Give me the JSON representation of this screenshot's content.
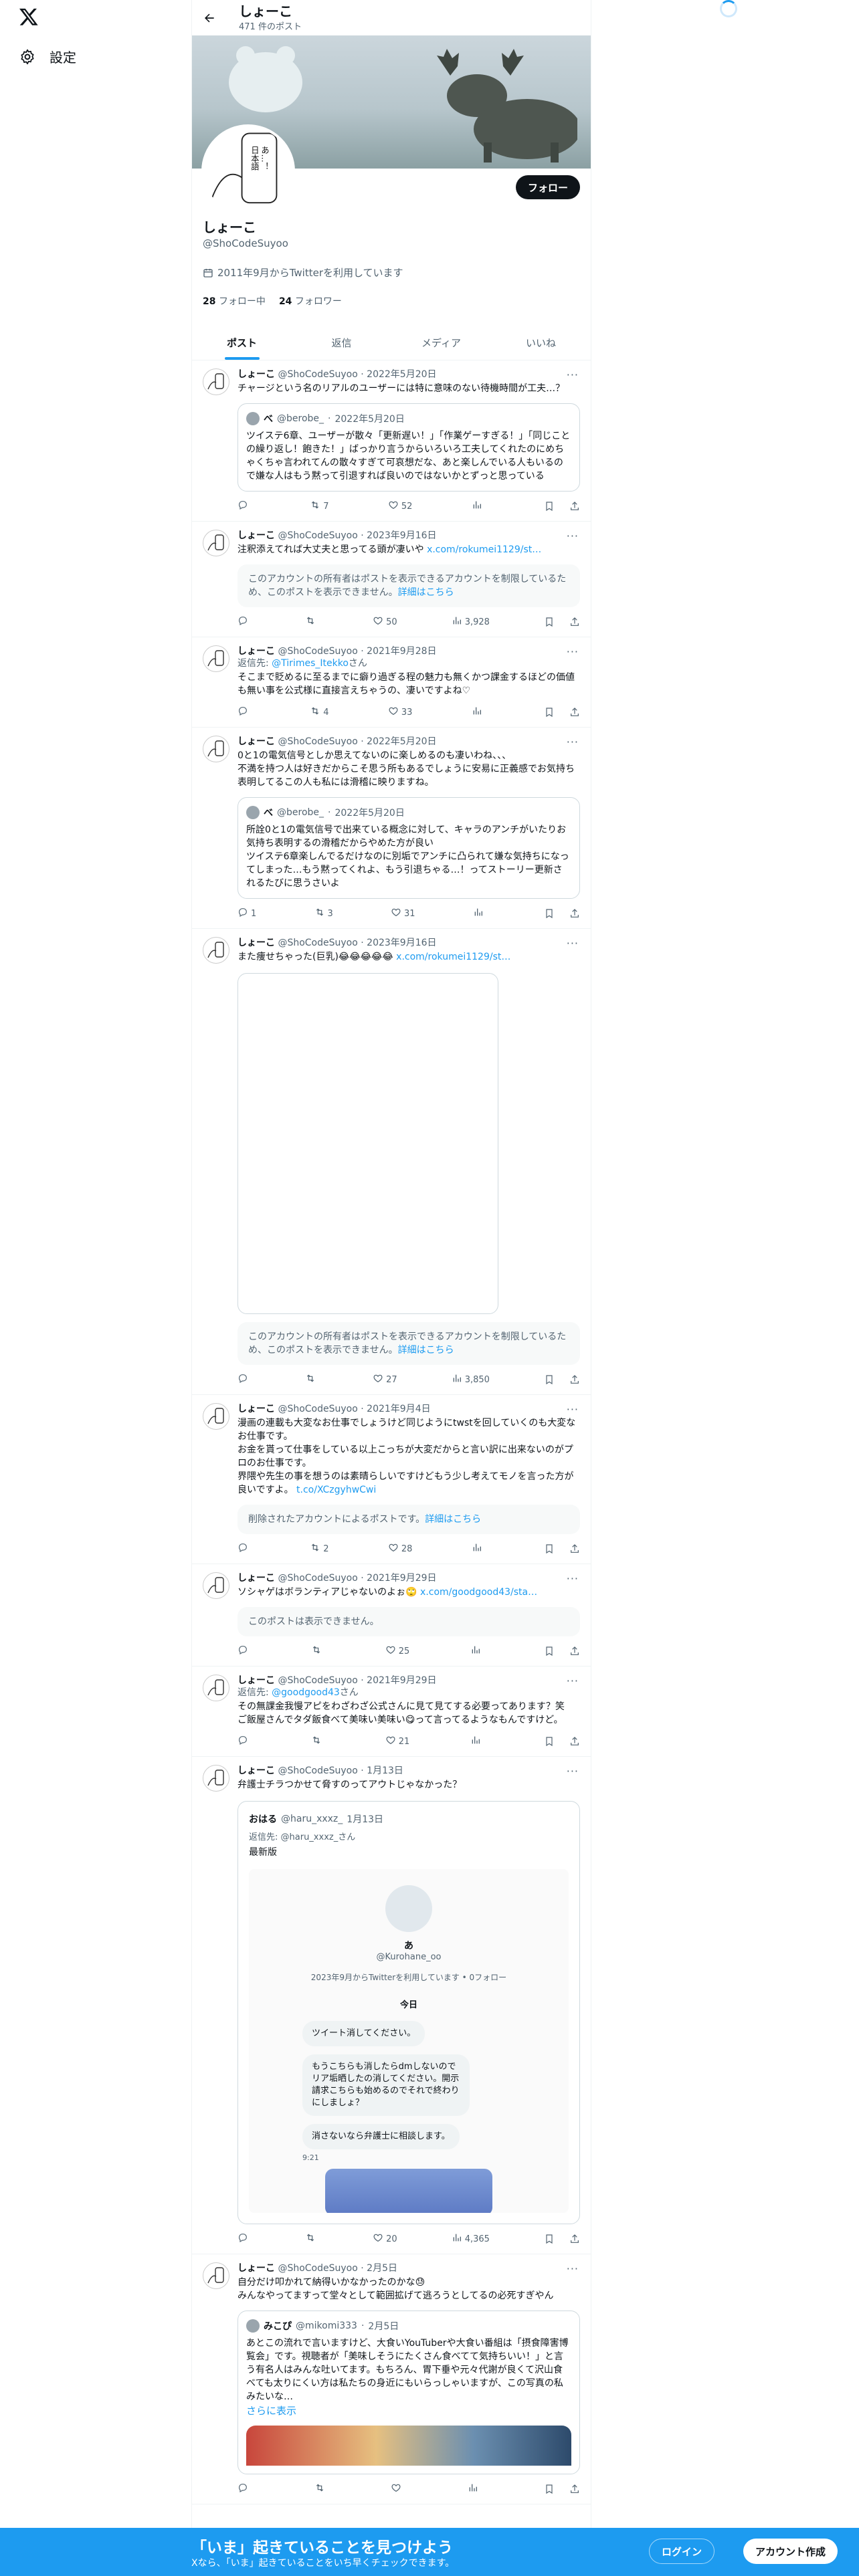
{
  "settings_label": "設定",
  "header": {
    "title": "しょーこ",
    "post_count": "471 件のポスト"
  },
  "banner": {
    "vertical_text": "あ…！日本語むずかちな…"
  },
  "follow_label": "フォロー",
  "profile": {
    "name": "しょーこ",
    "handle": "@ShoCodeSuyoo",
    "joined": "2011年9月からTwitterを利用しています",
    "following_count": "28",
    "following_label": "フォロー中",
    "followers_count": "24",
    "followers_label": "フォロワー"
  },
  "tabs": [
    "ポスト",
    "返信",
    "メディア",
    "いいね"
  ],
  "posts": [
    {
      "name": "しょーこ",
      "handle": "@ShoCodeSuyoo",
      "date": "2022年5月20日",
      "text": "チャージという名のリアルのユーザーには特に意味のない待機時間が工夫…？",
      "quote": {
        "name": "べ",
        "handle": "@berobe_",
        "date": "2022年5月20日",
        "text": "ツイステ6章、ユーザーが散々「更新遅い！」「作業ゲーすぎる！」「同じことの繰り返し！飽きた！」ばっかり言うからいろいろ工夫してくれたのにめちゃくちゃ言われてんの散々すぎて可哀想だな、あと楽しんでいる人もいるので嫌な人はもう黙って引退すれば良いのではないかとずっと思っている"
      },
      "replies": "",
      "reposts": "7",
      "likes": "52",
      "views": ""
    },
    {
      "name": "しょーこ",
      "handle": "@ShoCodeSuyoo",
      "date": "2023年9月16日",
      "text": "注釈添えてれば大丈夫と思ってる頭が凄いや ",
      "link": "x.com/rokumei1129/st…",
      "notice": "このアカウントの所有者はポストを表示できるアカウントを制限しているため、このポストを表示できません。",
      "notice_link": "詳細はこちら",
      "replies": "",
      "reposts": "",
      "likes": "50",
      "views": "3,928"
    },
    {
      "name": "しょーこ",
      "handle": "@ShoCodeSuyoo",
      "date": "2021年9月28日",
      "reply_to_label": "返信先: ",
      "reply_to": "@Tirimes_Itekko",
      "reply_suffix": "さん",
      "text": "そこまで貶めるに至るまでに癖り過ぎる程の魅力も無くかつ課金するほどの価値も無い事を公式様に直接言えちゃうの、凄いですよね♡",
      "replies": "",
      "reposts": "4",
      "likes": "33",
      "views": ""
    },
    {
      "name": "しょーこ",
      "handle": "@ShoCodeSuyoo",
      "date": "2022年5月20日",
      "text": "0と1の電気信号としか思えてないのに楽しめるのも凄いわね、、、\n不満を持つ人は好きだからこそ思う所もあるでしょうに安易に正義感でお気持ち表明してるこの人も私には滑稽に映りますね。",
      "quote": {
        "name": "べ",
        "handle": "@berobe_",
        "date": "2022年5月20日",
        "text": "所詮0と1の電気信号で出来ている概念に対して、キャラのアンチがいたりお気持ち表明するの滑稽だからやめた方が良い\nツイステ6章楽しんでるだけなのに別垢でアンチに凸られて嫌な気持ちになってしまった…もう黙ってくれよ、もう引退ちゃる…！ってストーリー更新されるたびに思うさいよ"
      },
      "replies": "1",
      "reposts": "3",
      "likes": "31",
      "views": ""
    },
    {
      "name": "しょーこ",
      "handle": "@ShoCodeSuyoo",
      "date": "2023年9月16日",
      "text": "また痩せちゃった(巨乳)😂😂😂😂😂 ",
      "link": "x.com/rokumei1129/st…",
      "notice": "このアカウントの所有者はポストを表示できるアカウントを制限しているため、このポストを表示できません。",
      "notice_link": "詳細はこちら",
      "replies": "",
      "reposts": "",
      "likes": "27",
      "views": "3,850"
    },
    {
      "name": "しょーこ",
      "handle": "@ShoCodeSuyoo",
      "date": "2021年9月4日",
      "text": "漫画の連載も大変なお仕事でしょうけど同じようにtwstを回していくのも大変なお仕事です。\nお金を貰って仕事をしている以上こっちが大変だからと言い訳に出来ないのがプロのお仕事です。\n界隈や先生の事を想うのは素晴らしいですけどもう少し考えてモノを言った方が良いですよ。 ",
      "link": "t.co/XCzgyhwCwi",
      "notice": "削除されたアカウントによるポストです。",
      "notice_link": "詳細はこちら",
      "replies": "",
      "reposts": "2",
      "likes": "28",
      "views": ""
    },
    {
      "name": "しょーこ",
      "handle": "@ShoCodeSuyoo",
      "date": "2021年9月29日",
      "text": "ソシャゲはボランティアじゃないのよぉ🙄 ",
      "link": "x.com/goodgood43/sta…",
      "notice": "このポストは表示できません。",
      "notice_link": "",
      "replies": "",
      "reposts": "",
      "likes": "25",
      "views": ""
    },
    {
      "name": "しょーこ",
      "handle": "@ShoCodeSuyoo",
      "date": "2021年9月29日",
      "reply_to_label": "返信先: ",
      "reply_to": "@goodgood43",
      "reply_suffix": "さん",
      "text": "その無課金我慢アピをわざわざ公式さんに見て見てする必要ってあります？笑\nご飯屋さんでタダ飯食べて美味い美味い😋って言ってるようなもんですけど。",
      "replies": "",
      "reposts": "",
      "likes": "21",
      "views": ""
    },
    {
      "name": "しょーこ",
      "handle": "@ShoCodeSuyoo",
      "date": "1月13日",
      "text": "弁護士チラつかせて脅すのってアウトじゃなかった？",
      "chat": {
        "name": "おはる",
        "handle": "@haru_xxxz_",
        "date": "1月13日",
        "reply": "返信先: @haru_xxxz_さん",
        "label": "最新版",
        "profile_name": "あ",
        "profile_handle": "@Kurohane_oo",
        "profile_meta": "2023年9月からTwitterを利用しています • 0フォロー",
        "day": "今日",
        "bubbles": [
          "ツイート消してください。",
          "もうこちらも消したらdmしないので リア垢晒したの消してください。開示請求こちらも始めるのでそれで終わりにしましょ？",
          "消さないなら弁護士に相談します。"
        ],
        "time": "9:21"
      },
      "replies": "",
      "reposts": "",
      "likes": "20",
      "views": "4,365"
    },
    {
      "name": "しょーこ",
      "handle": "@ShoCodeSuyoo",
      "date": "2月5日",
      "text": "自分だけ叩かれて納得いかなかったのかな😓\nみんなやってますって堂々として範囲拡げて逃ろうとしてるの必死すぎやん",
      "quote": {
        "name": "みこぴ",
        "handle": "@mikomi333",
        "date": "2月5日",
        "text": "あとこの流れで言いますけど、大食いYouTuberや大食い番組は「摂食障害博覧会」です。視聴者が「美味しそうにたくさん食べてて気持ちいい！」と言う有名人はみんな吐いてます。もちろん、胃下垂や元々代謝が良くて沢山食べても太りにくい方は私たちの身近にもいらっしゃいますが、この写真の私みたいな…",
        "more": "さらに表示"
      },
      "replies": "",
      "reposts": "",
      "likes": "",
      "views": ""
    }
  ],
  "bottom": {
    "title": "「いま」起きていることを見つけよう",
    "subtitle": "Xなら、「いま」起きていることをいち早くチェックできます。",
    "login": "ログイン",
    "signup": "アカウント作成"
  },
  "colors": {
    "accent": "#1d9bf0",
    "text": "#0f1419",
    "muted": "#536471"
  }
}
